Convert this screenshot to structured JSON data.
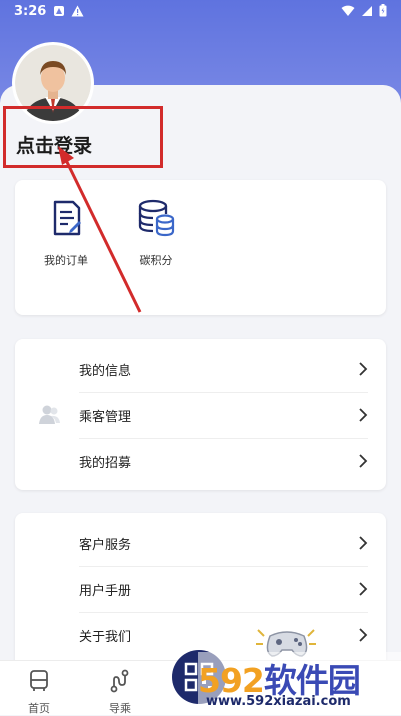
{
  "status_bar": {
    "time": "3:26"
  },
  "profile": {
    "login_label": "点击登录"
  },
  "shortcuts": [
    {
      "label": "我的订单",
      "icon": "order-document-icon"
    },
    {
      "label": "碳积分",
      "icon": "carbon-points-database-icon"
    }
  ],
  "menu_group_1": {
    "items": [
      {
        "label": "我的信息"
      },
      {
        "label": "乘客管理"
      },
      {
        "label": "我的招募"
      }
    ]
  },
  "menu_group_2": {
    "items": [
      {
        "label": "客户服务"
      },
      {
        "label": "用户手册"
      },
      {
        "label": "关于我们"
      }
    ]
  },
  "bottom_nav": {
    "items": [
      {
        "label": "首页",
        "icon": "bus-icon"
      },
      {
        "label": "导乘",
        "icon": "route-icon"
      }
    ],
    "qr_icon": "qr-code-icon"
  },
  "watermark": {
    "logo_num": "592",
    "logo_text": "软件园",
    "url": "www.592xiazai.com"
  },
  "colors": {
    "header": "#6f80e2",
    "annotation": "#d22b2b",
    "icon_navy": "#1e2a6b"
  }
}
